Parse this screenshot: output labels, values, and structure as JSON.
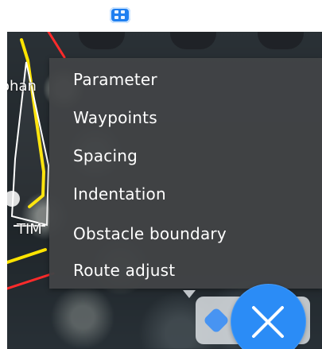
{
  "menu": {
    "items": [
      {
        "label": "Parameter"
      },
      {
        "label": "Waypoints"
      },
      {
        "label": "Spacing"
      },
      {
        "label": "Indentation"
      },
      {
        "label": "Obstacle boundary"
      },
      {
        "label": "Route adjust"
      }
    ]
  },
  "map_labels": {
    "left_name_fragment": "ohan",
    "left_bottom_fragment": "TIM"
  },
  "colors": {
    "primary_blue": "#2b8cf6",
    "menu_bg": "#424446",
    "route_yellow": "#ffe400",
    "route_red": "#ff2b2b"
  },
  "icons": {
    "top_chip": "grid-icon",
    "close": "close-icon",
    "small_chip": "layer-icon"
  }
}
